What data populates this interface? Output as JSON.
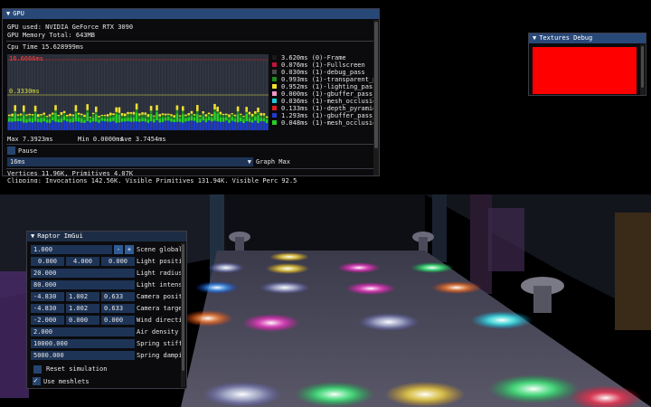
{
  "gpu_window": {
    "title": "GPU",
    "gpu_used": "GPU used: NVIDIA GeForce RTX 3090",
    "gpu_memory": "GPU Memory Total: 643MB",
    "cpu_time": "Cpu Time 15.628999ms",
    "graph_top_label": "16.6666ms",
    "graph_mid_label": "0.3330ms",
    "legend": [
      {
        "text": "3.620ms (0)-Frame",
        "color": "#1a1a1a"
      },
      {
        "text": "0.076ms (1)-Fullscreen",
        "color": "#c0143c"
      },
      {
        "text": "0.030ms (1)-debug_pass",
        "color": "#4a4a4a"
      },
      {
        "text": "0.993ms (1)-transparent_p",
        "color": "#1e8c1e"
      },
      {
        "text": "0.952ms (1)-lighting_pass",
        "color": "#f0e030"
      },
      {
        "text": "0.000ms (1)-gbuffer_pass_",
        "color": "#f096c8"
      },
      {
        "text": "0.036ms (1)-mesh_occlusio",
        "color": "#20c8d8"
      },
      {
        "text": "0.133ms (1)-depth_pyramid",
        "color": "#e01e1e"
      },
      {
        "text": "1.293ms (1)-gbuffer_pass_",
        "color": "#1e3cc8"
      },
      {
        "text": "0.048ms (1)-mesh_occlusio",
        "color": "#28d028"
      }
    ],
    "stats": {
      "max": "Max 7.3923ms",
      "min": "Min 0.0000ms",
      "ave": "Ave 3.7454ms"
    },
    "pause_label": "Pause",
    "graph_max_value": "16ms",
    "graph_max_label": "Graph Max",
    "vertices": "Vertices 11.96K, Primitives 4.07K",
    "clipping": "Clipping: Invocations 142.56K, Visible Primitives 131.94K, Visible Perc 92.5"
  },
  "textures_window": {
    "title": "Textures Debug",
    "color": "#ff0000"
  },
  "raptor_window": {
    "title": "Raptor ImGui",
    "scene_global": {
      "value": "1.000",
      "minus": "-",
      "plus": "+",
      "label": "Scene global"
    },
    "light_position": {
      "x": "0.000",
      "y": "4.000",
      "z": "0.000",
      "label": "Light positi"
    },
    "light_radius": {
      "value": "20.000",
      "label": "Light radius"
    },
    "light_intensity": {
      "value": "80.000",
      "label": "Light intens"
    },
    "camera_position": {
      "x": "-4.830",
      "y": "1.002",
      "z": "0.633",
      "label": "Camera posit"
    },
    "camera_target": {
      "x": "-4.830",
      "y": "1.002",
      "z": "0.633",
      "label": "Camera targe"
    },
    "wind_direction": {
      "x": "-2.000",
      "y": "0.000",
      "z": "0.000",
      "label": "Wind directi"
    },
    "air_density": {
      "value": "2.000",
      "label": "Air density"
    },
    "spring_stiffness": {
      "value": "10000.000",
      "label": "Spring stiff"
    },
    "spring_damping": {
      "value": "5000.000",
      "label": "Spring dampi"
    },
    "reset_label": "Reset simulation",
    "use_meshlets_label": "Use meshlets",
    "use_meshlets_checked": true
  }
}
